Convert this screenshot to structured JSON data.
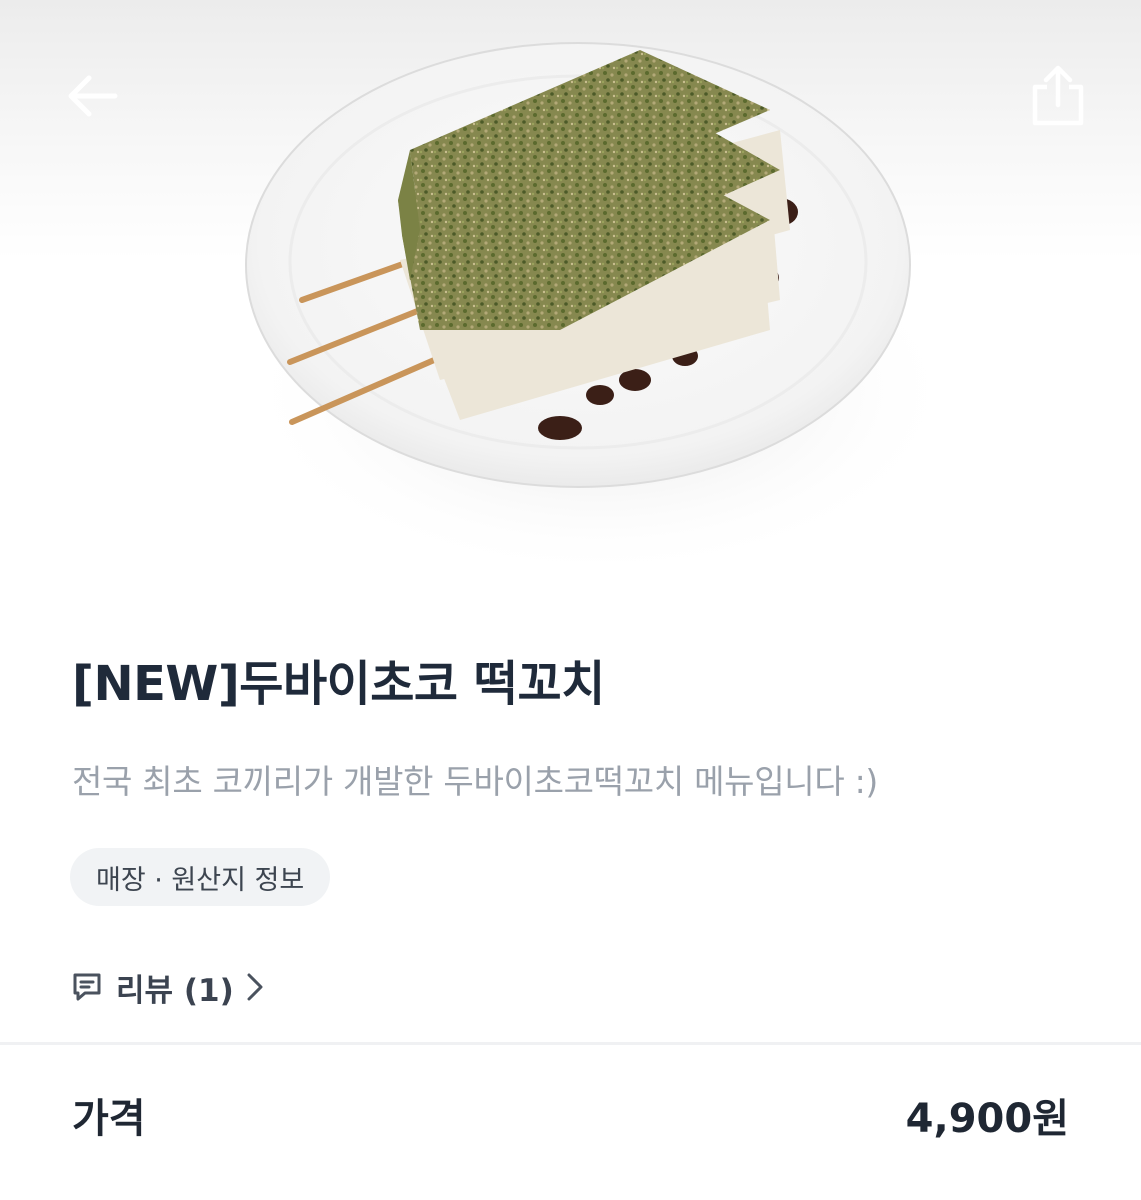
{
  "header": {
    "back_icon": "arrow-left-icon",
    "share_icon": "share-icon"
  },
  "product": {
    "title": "[NEW]두바이초코 떡꼬치",
    "description": "전국 최초 코끼리가 개발한 두바이초코떡꼬치 메뉴입니다 :)",
    "origin_chip_label": "매장 · 원산지 정보",
    "review_label": "리뷰 (1)",
    "review_icon": "chat-bubble-icon",
    "chevron_icon": "chevron-right-icon"
  },
  "price": {
    "label": "가격",
    "value": "4,900원"
  },
  "colors": {
    "title": "#1f2a3a",
    "description": "#9aa1ab",
    "chip_background": "#f1f3f5",
    "pistachio_green": "#6e7a3e",
    "chocolate": "#3b1f17"
  }
}
